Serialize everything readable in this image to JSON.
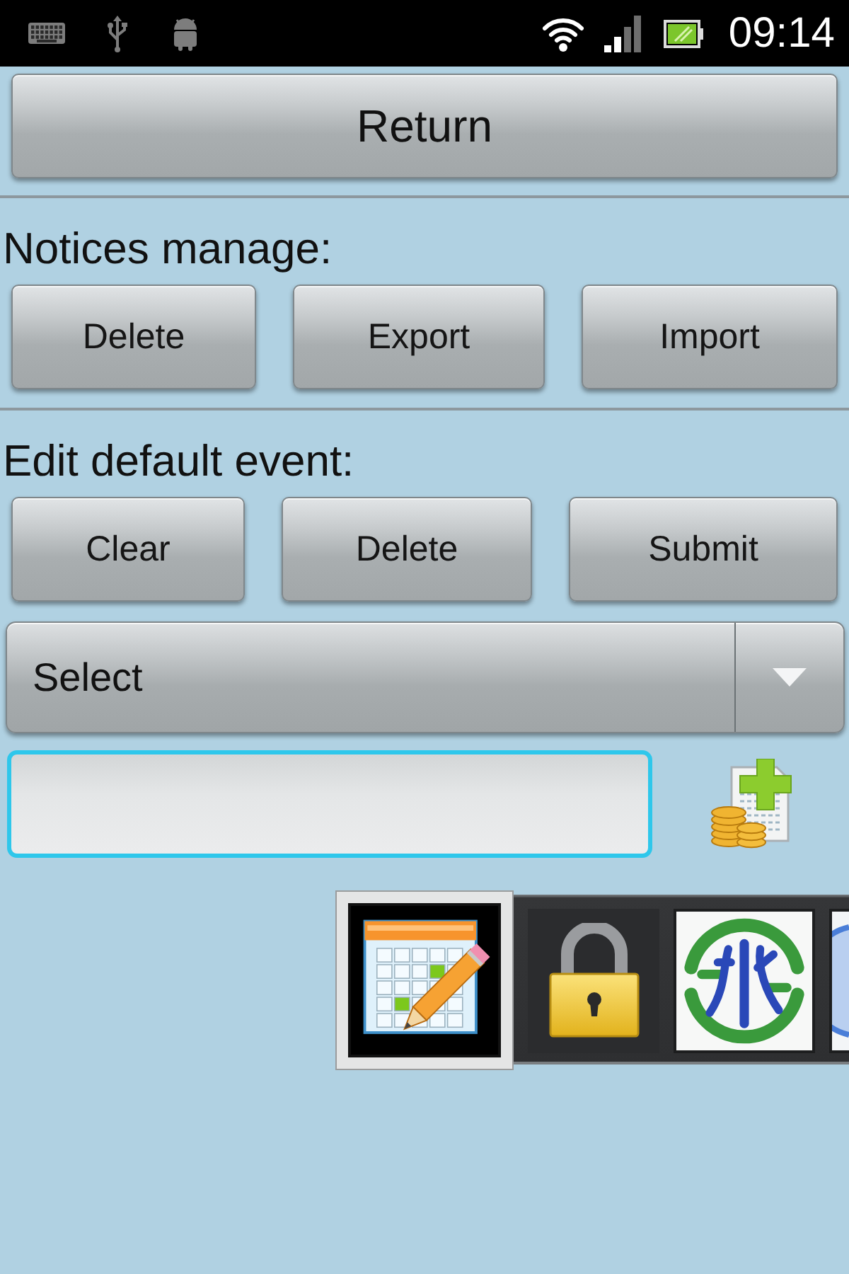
{
  "status_bar": {
    "time": "09:14"
  },
  "return_button": {
    "label": "Return"
  },
  "sections": [
    {
      "title": "Notices manage:",
      "buttons": [
        "Delete",
        "Export",
        "Import"
      ]
    },
    {
      "title": "Edit default event:",
      "buttons": [
        "Clear",
        "Delete",
        "Submit"
      ]
    }
  ],
  "select": {
    "value": "Select"
  },
  "input": {
    "focused": true
  },
  "gallery": {
    "items": [
      {
        "kind": "calendar",
        "selected": true
      },
      {
        "kind": "padlock",
        "selected": false
      },
      {
        "kind": "emblem",
        "selected": false
      },
      {
        "kind": "circle",
        "selected": false
      }
    ]
  }
}
